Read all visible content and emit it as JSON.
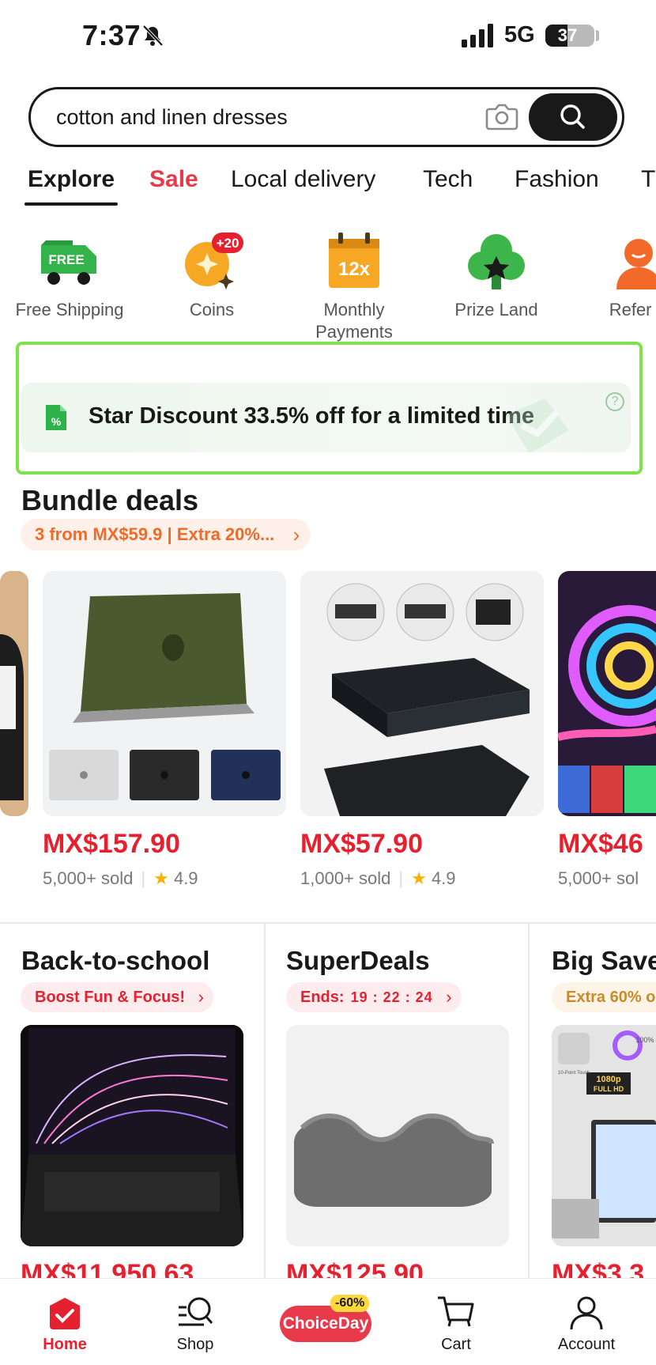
{
  "status_bar": {
    "time": "7:37",
    "network": "5G",
    "battery": "37"
  },
  "search": {
    "query": "cotton and linen dresses"
  },
  "tabs": [
    {
      "label": "Explore"
    },
    {
      "label": "Sale"
    },
    {
      "label": "Local delivery"
    },
    {
      "label": "Tech"
    },
    {
      "label": "Fashion"
    },
    {
      "label": "T"
    }
  ],
  "quick_links": [
    {
      "label": "Free Shipping",
      "icon": "free-shipping-truck-icon",
      "badge": "FREE"
    },
    {
      "label": "Coins",
      "icon": "coins-icon",
      "badge": "+20"
    },
    {
      "label": "Monthly Payments",
      "icon": "calendar-icon",
      "badge": "12x"
    },
    {
      "label": "Prize Land",
      "icon": "prize-tree-icon"
    },
    {
      "label": "Refer &",
      "icon": "refer-person-icon"
    }
  ],
  "promo": {
    "text": "Star Discount 33.5% off for a limited time",
    "help": "?"
  },
  "bundle": {
    "title": "Bundle deals",
    "pill": "3 from MX$59.9 | Extra 20%...",
    "products": [
      {
        "price": "MX$157.90",
        "sold": "5,000+ sold",
        "rating": "4.9"
      },
      {
        "price": "MX$57.90",
        "sold": "1,000+ sold",
        "rating": "4.9"
      },
      {
        "price": "MX$46",
        "sold": "5,000+ sol"
      }
    ]
  },
  "sections": [
    {
      "title": "Back-to-school",
      "pill": "Boost Fun & Focus!",
      "price": "MX$11,950.63"
    },
    {
      "title": "SuperDeals",
      "pill": "Ends:",
      "timer": "19 : 22 : 24",
      "price": "MX$125.90"
    },
    {
      "title": "Big Save",
      "pill": "Extra 60% o",
      "price": "MX$3,3",
      "img_badges": [
        "100%",
        "10-Point Touch",
        "1080p",
        "FULL HD"
      ]
    }
  ],
  "nav": {
    "home": "Home",
    "shop": "Shop",
    "choice": "ChoiceDay",
    "choice_badge": "-60%",
    "cart": "Cart",
    "account": "Account"
  },
  "colors": {
    "accent": "#e5202f",
    "sale": "#e83a4b",
    "bundle_pill": "#f06a28",
    "highlight": "#7ee24a"
  }
}
